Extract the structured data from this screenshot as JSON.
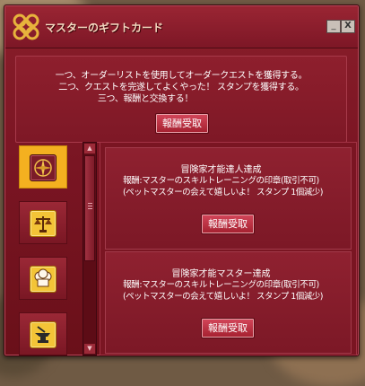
{
  "window": {
    "title": "マスターのギフトカード",
    "minimize": "_",
    "close": "X"
  },
  "intro": {
    "lines": [
      "一つ、オーダーリストを使用してオーダークエストを獲得する。",
      "二つ、クエストを完遂してよくやった！ スタンプを獲得する。",
      "三つ、報酬と交換する！"
    ],
    "claim_label": "報酬受取"
  },
  "sidebar": {
    "items": [
      {
        "icon": "compass-icon",
        "selected": true
      },
      {
        "icon": "scales-icon",
        "selected": false
      },
      {
        "icon": "chef-hat-icon",
        "selected": false
      },
      {
        "icon": "anvil-icon",
        "selected": false
      }
    ]
  },
  "quests": [
    {
      "title": "冒険家才能達人達成",
      "reward": "報酬:マスターのスキルトレーニングの印章(取引不可)",
      "note": "(ペットマスターの会えて嬉しいよ！ スタンプ 1個減少)",
      "claim_label": "報酬受取"
    },
    {
      "title": "冒険家才能マスター達成",
      "reward": "報酬:マスターのスキルトレーニングの印章(取引不可)",
      "note": "(ペットマスターの会えて嬉しいよ！ スタンプ 1個減少)",
      "claim_label": "報酬受取"
    }
  ],
  "colors": {
    "window_bg": "#7a1523",
    "accent_gold": "#f4b020",
    "button_red": "#c23445"
  }
}
